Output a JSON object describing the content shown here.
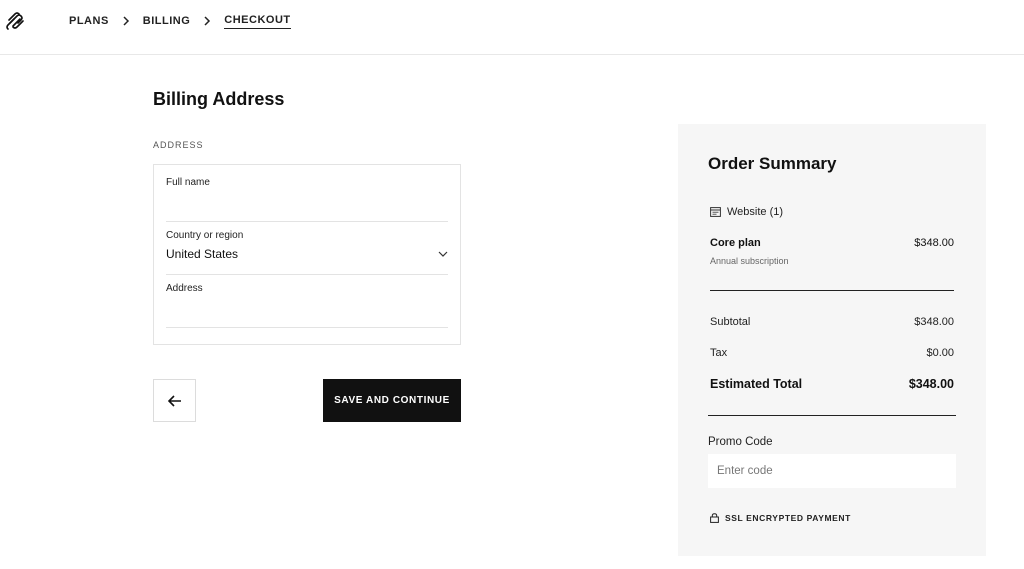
{
  "breadcrumb": {
    "items": [
      {
        "label": "PLANS",
        "active": false
      },
      {
        "label": "BILLING",
        "active": false
      },
      {
        "label": "CHECKOUT",
        "active": true
      }
    ]
  },
  "form": {
    "title": "Billing Address",
    "section_label": "ADDRESS",
    "full_name": {
      "label": "Full name",
      "value": "",
      "placeholder": ""
    },
    "country": {
      "label": "Country or region",
      "value": "United States"
    },
    "address": {
      "label": "Address",
      "value": "",
      "placeholder": ""
    },
    "save_label": "SAVE AND CONTINUE"
  },
  "summary": {
    "title": "Order Summary",
    "site_label": "Website (1)",
    "plan_name": "Core plan",
    "plan_price": "$348.00",
    "plan_sub": "Annual subscription",
    "subtotal_label": "Subtotal",
    "subtotal_value": "$348.00",
    "tax_label": "Tax",
    "tax_value": "$0.00",
    "total_label": "Estimated Total",
    "total_value": "$348.00",
    "promo_label": "Promo Code",
    "promo_placeholder": "Enter code",
    "ssl_label": "SSL ENCRYPTED PAYMENT"
  },
  "icons": {
    "logo": "squarespace-logo-icon",
    "separator": "chevron-right-icon",
    "select": "chevron-down-icon",
    "back": "arrow-left-icon",
    "site": "browser-window-icon",
    "lock": "lock-icon"
  }
}
